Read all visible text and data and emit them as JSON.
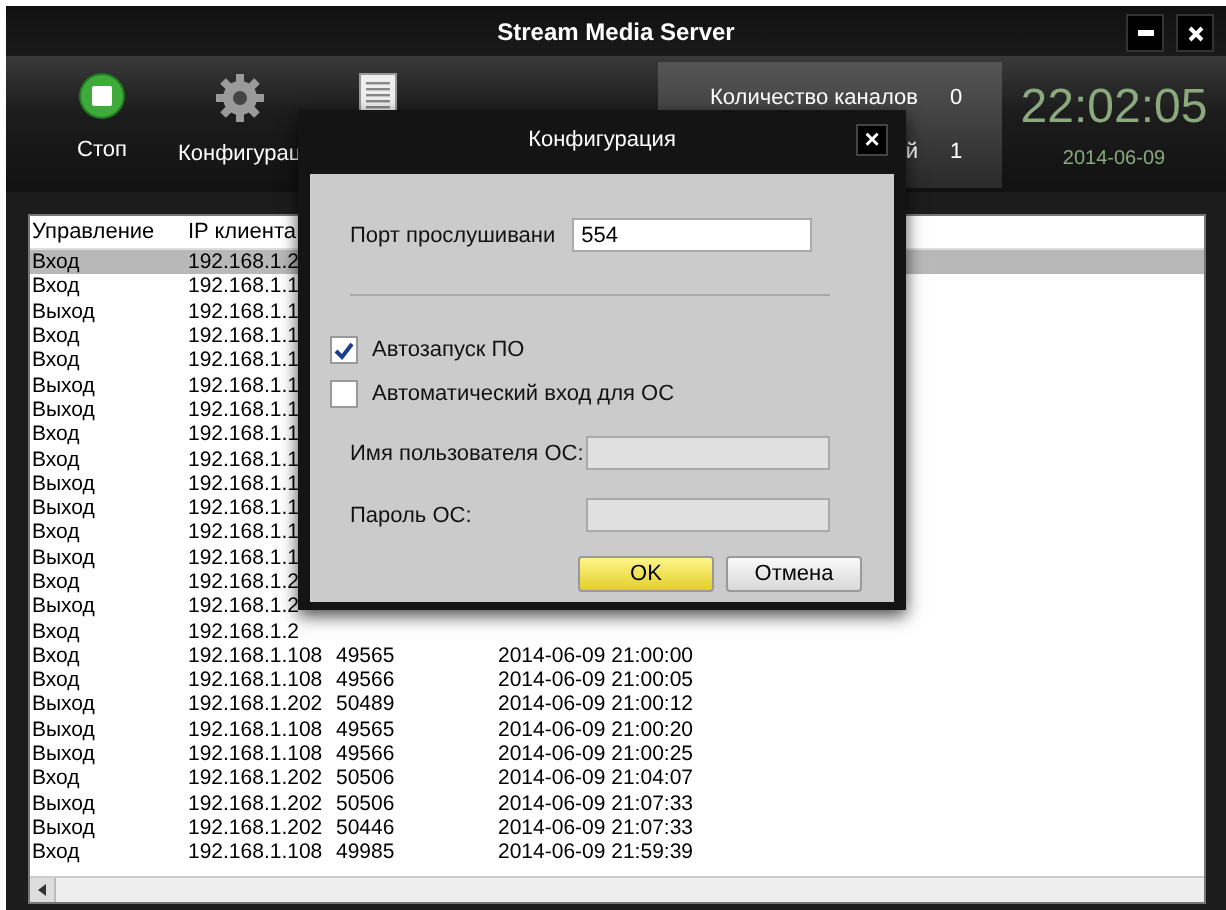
{
  "window": {
    "title": "Stream Media Server"
  },
  "toolbar": [
    {
      "kind": "stop",
      "label": "Стоп"
    },
    {
      "kind": "config",
      "label": "Конфигурац"
    },
    {
      "kind": "log"
    }
  ],
  "stats": [
    {
      "label": "Количество каналов",
      "value": "0"
    },
    {
      "label": "й",
      "value": "1"
    }
  ],
  "clock": {
    "time": "22:02:05",
    "date": "2014-06-09"
  },
  "table": {
    "columns": [
      "Управление",
      "IP клиента"
    ],
    "rows": [
      {
        "action": "Вход",
        "ip": "192.168.1.2",
        "selected": true
      },
      {
        "action": "Вход",
        "ip": "192.168.1.1",
        "selected": false
      },
      {
        "action": "Выход",
        "ip": "192.168.1.1",
        "selected": false
      },
      {
        "action": "Вход",
        "ip": "192.168.1.1",
        "selected": false
      },
      {
        "action": "Вход",
        "ip": "192.168.1.1",
        "selected": false
      },
      {
        "action": "Выход",
        "ip": "192.168.1.1",
        "selected": false
      },
      {
        "action": "Выход",
        "ip": "192.168.1.1",
        "selected": false
      },
      {
        "action": "Вход",
        "ip": "192.168.1.1",
        "selected": false
      },
      {
        "action": "Вход",
        "ip": "192.168.1.1",
        "selected": false
      },
      {
        "action": "Выход",
        "ip": "192.168.1.1",
        "selected": false
      },
      {
        "action": "Выход",
        "ip": "192.168.1.1",
        "selected": false
      },
      {
        "action": "Вход",
        "ip": "192.168.1.1",
        "selected": false
      },
      {
        "action": "Выход",
        "ip": "192.168.1.1",
        "selected": false
      },
      {
        "action": "Вход",
        "ip": "192.168.1.2",
        "selected": false
      },
      {
        "action": "Выход",
        "ip": "192.168.1.2",
        "selected": false
      },
      {
        "action": "Вход",
        "ip": "192.168.1.2",
        "selected": false
      },
      {
        "action": "Вход",
        "ip": "192.168.1.108",
        "port": "49565",
        "time": "2014-06-09 21:00:00",
        "selected": false
      },
      {
        "action": "Вход",
        "ip": "192.168.1.108",
        "port": "49566",
        "time": "2014-06-09 21:00:05",
        "selected": false
      },
      {
        "action": "Выход",
        "ip": "192.168.1.202",
        "port": "50489",
        "time": "2014-06-09 21:00:12",
        "selected": false
      },
      {
        "action": "Выход",
        "ip": "192.168.1.108",
        "port": "49565",
        "time": "2014-06-09 21:00:20",
        "selected": false
      },
      {
        "action": "Выход",
        "ip": "192.168.1.108",
        "port": "49566",
        "time": "2014-06-09 21:00:25",
        "selected": false
      },
      {
        "action": "Вход",
        "ip": "192.168.1.202",
        "port": "50506",
        "time": "2014-06-09 21:04:07",
        "selected": false
      },
      {
        "action": "Выход",
        "ip": "192.168.1.202",
        "port": "50506",
        "time": "2014-06-09 21:07:33",
        "selected": false
      },
      {
        "action": "Выход",
        "ip": "192.168.1.202",
        "port": "50446",
        "time": "2014-06-09 21:07:33",
        "selected": false
      },
      {
        "action": "Вход",
        "ip": "192.168.1.108",
        "port": "49985",
        "time": "2014-06-09 21:59:39",
        "selected": false
      }
    ]
  },
  "dialog": {
    "title": "Конфигурация",
    "close": "×",
    "port": {
      "label": "Порт прослушивани",
      "value": "554"
    },
    "checkboxes": [
      {
        "label": "Автозапуск ПО",
        "checked": true
      },
      {
        "label": "Автоматический вход для ОС",
        "checked": false
      }
    ],
    "fields": [
      {
        "label": "Имя пользователя ОС:",
        "disabled": true
      },
      {
        "label": "Пароль ОС:",
        "disabled": true
      }
    ],
    "buttons": [
      {
        "label": "OK",
        "kind": "primary"
      },
      {
        "label": "Отмена",
        "kind": "secondary"
      }
    ]
  }
}
